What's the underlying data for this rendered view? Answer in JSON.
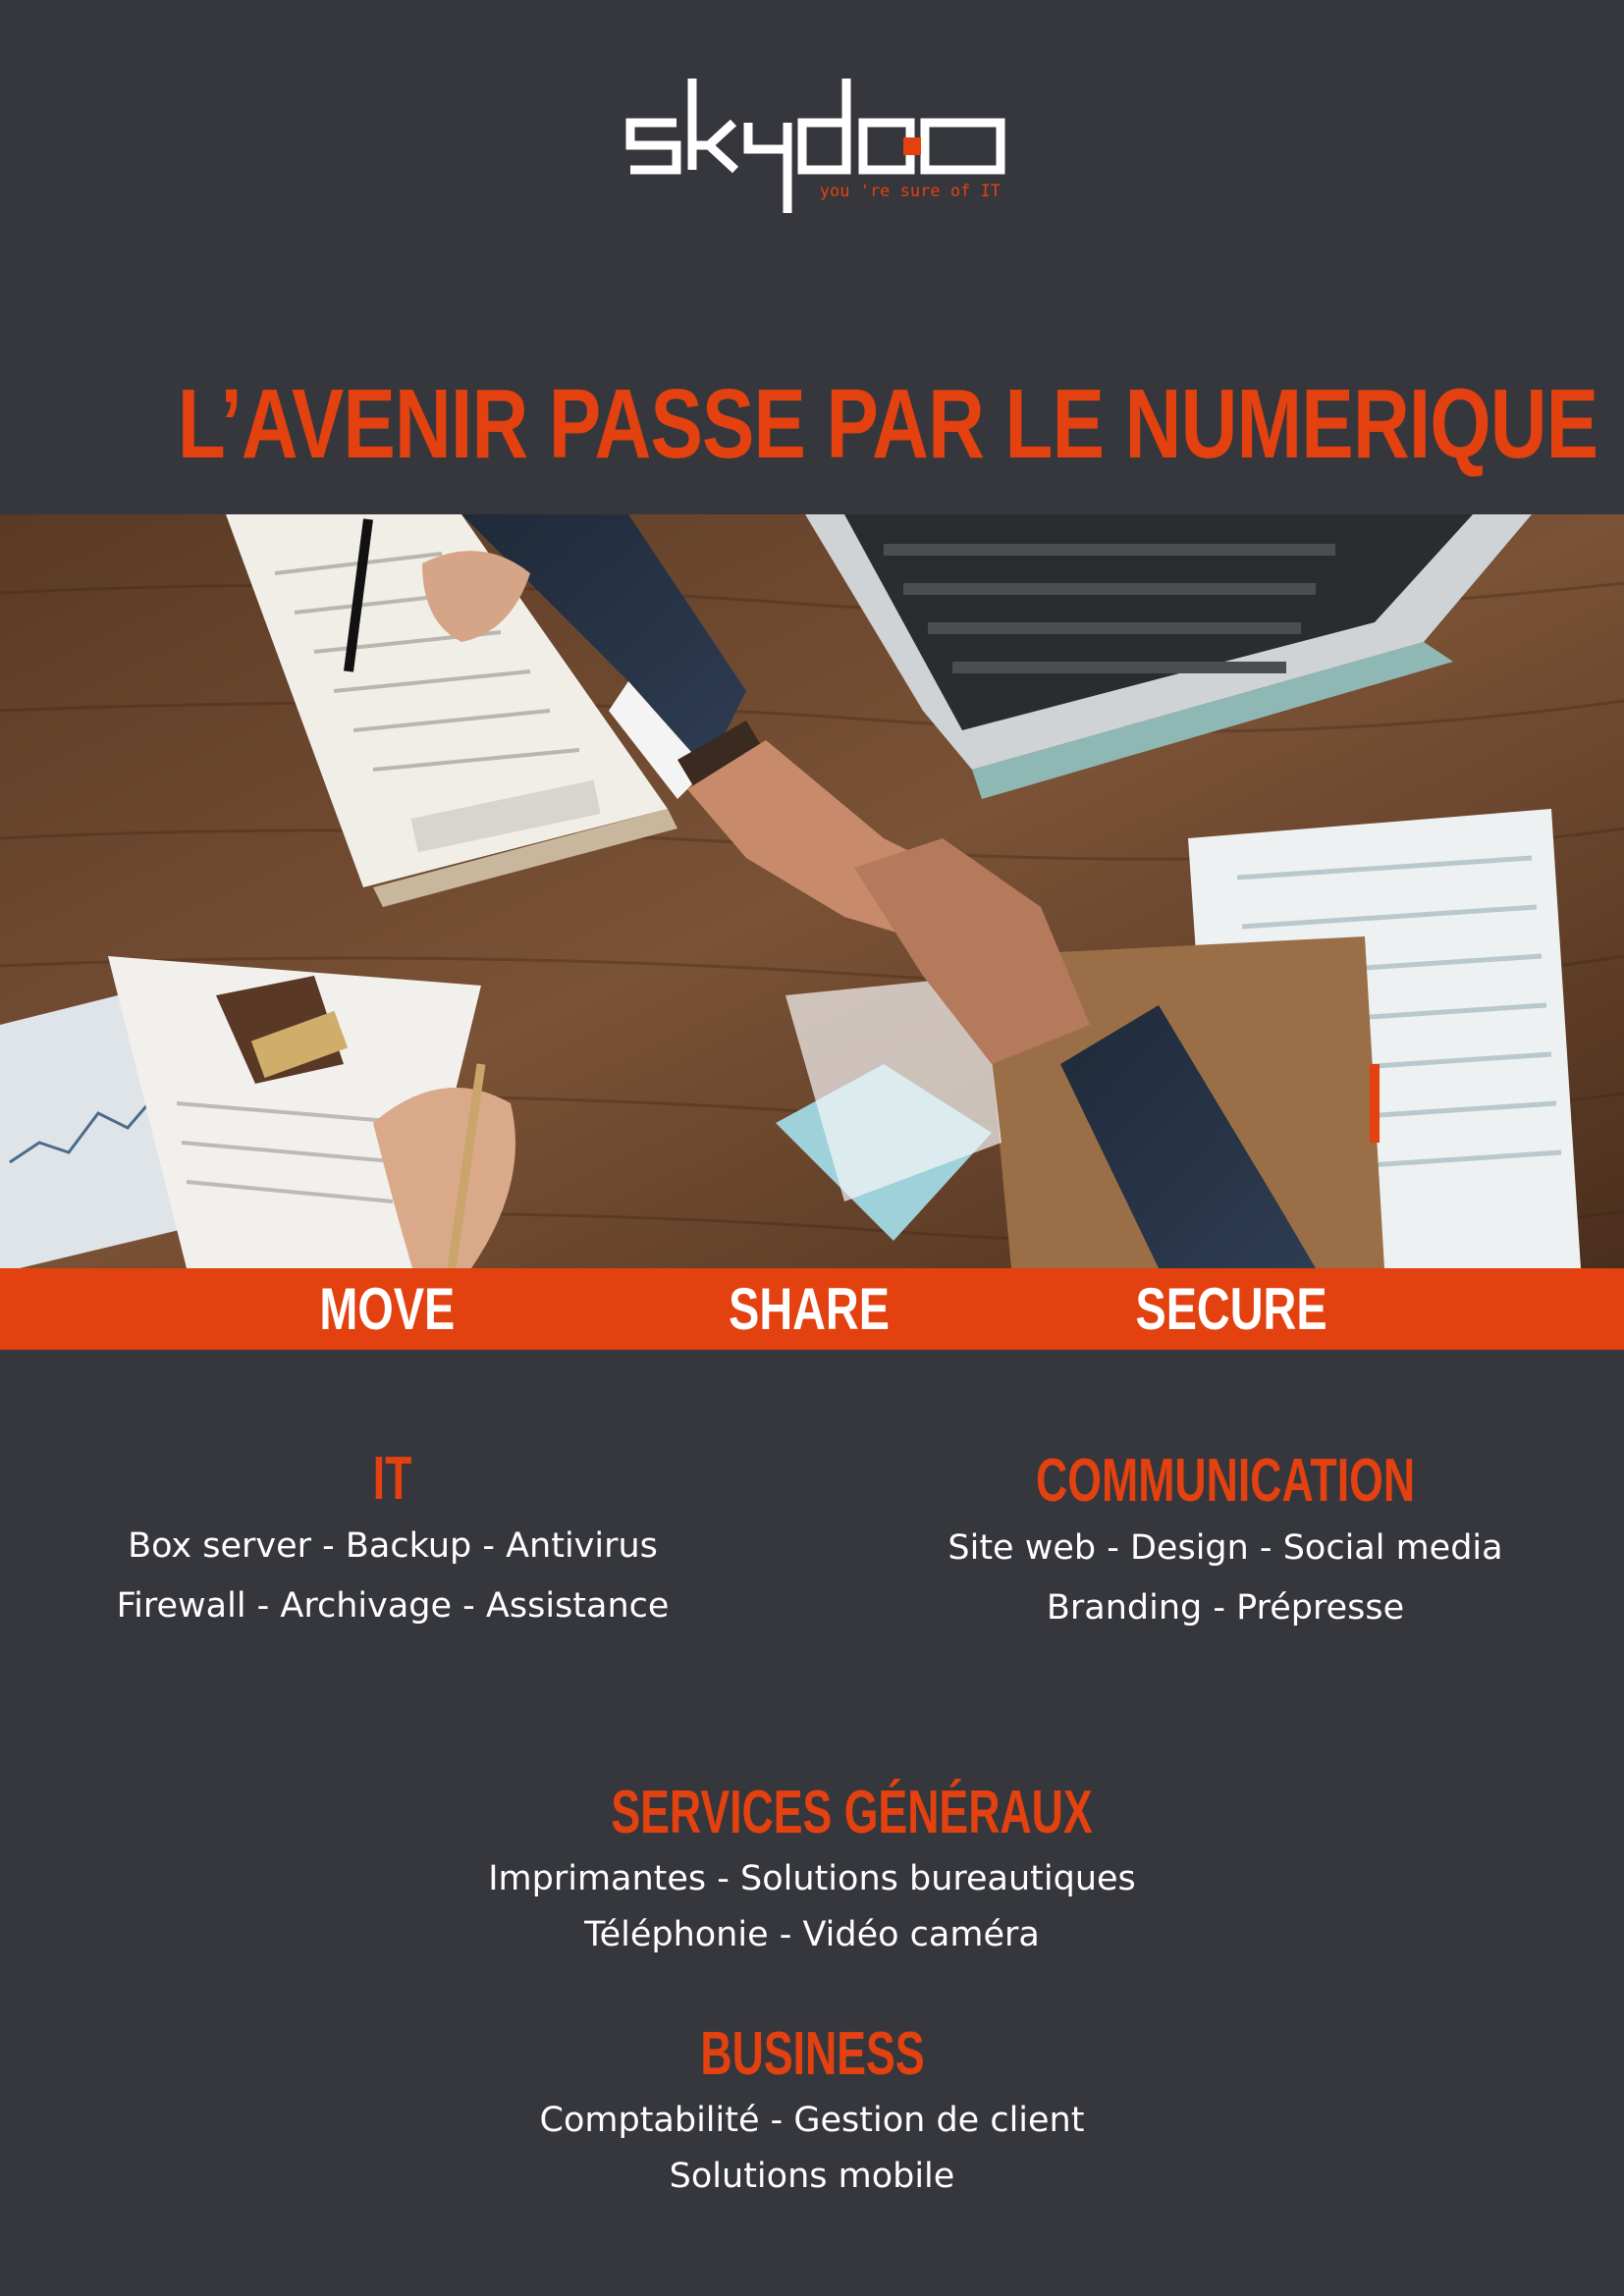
{
  "brand": {
    "name": "skydoo",
    "tagline": "you 're sure of IT",
    "colors": {
      "accent": "#e3410f",
      "background": "#36373c",
      "text": "#ffffff"
    }
  },
  "headline": "L’AVENIR PASSE PAR LE NUMERIQUE",
  "hero_image": {
    "subject": "business-handshake-photo"
  },
  "band": {
    "words": [
      "MOVE",
      "SHARE",
      "SECURE"
    ]
  },
  "services": {
    "it": {
      "title": "IT",
      "lines": [
        "Box server - Backup - Antivirus",
        "Firewall - Archivage - Assistance"
      ]
    },
    "communication": {
      "title": "COMMUNICATION",
      "lines": [
        "Site web - Design - Social media",
        "Branding - Prépresse"
      ]
    },
    "services_generaux": {
      "title": "SERVICES GÉNÉRAUX",
      "lines": [
        "Imprimantes - Solutions bureautiques",
        "Téléphonie - Vidéo caméra"
      ]
    },
    "business": {
      "title": "BUSINESS",
      "lines": [
        "Comptabilité - Gestion de client",
        "Solutions mobile"
      ]
    }
  }
}
